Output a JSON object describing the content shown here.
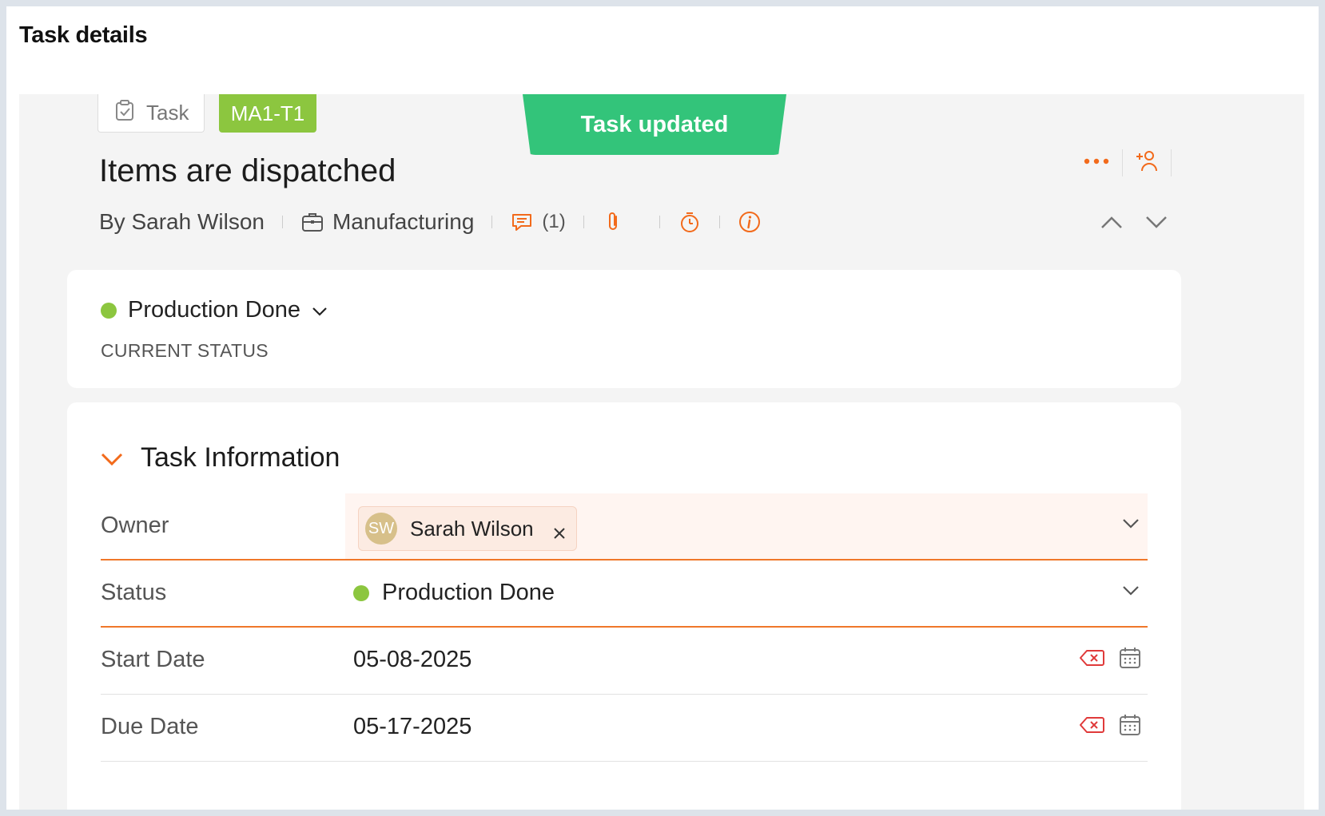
{
  "page": {
    "title": "Task details"
  },
  "header": {
    "type_chip": "Task",
    "task_id": "MA1-T1",
    "toast": "Task updated",
    "task_title": "Items are dispatched",
    "author": "By Sarah Wilson",
    "project": "Manufacturing",
    "comments_count": "(1)"
  },
  "current_status": {
    "value": "Production Done",
    "caption": "CURRENT STATUS",
    "color": "#8cc63f"
  },
  "task_information": {
    "heading": "Task Information",
    "fields": [
      {
        "label": "Owner",
        "value": "Sarah Wilson",
        "avatar_initials": "SW"
      },
      {
        "label": "Status",
        "value": "Production Done"
      },
      {
        "label": "Start Date",
        "value": "05-08-2025"
      },
      {
        "label": "Due Date",
        "value": "05-17-2025"
      }
    ]
  },
  "colors": {
    "accent": "#f26a1b",
    "toast": "#33c47a",
    "id_badge": "#8cc63f"
  }
}
